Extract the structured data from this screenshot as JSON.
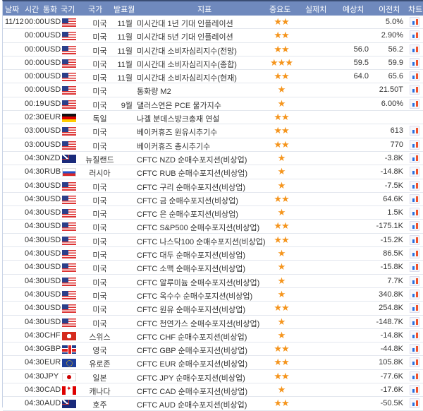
{
  "header": {
    "date": "날짜",
    "time": "시간",
    "currency": "통화",
    "flag": "국기",
    "country": "국가",
    "month": "발표월",
    "indicator": "지표",
    "importance": "중요도",
    "actual": "실제치",
    "forecast": "예상치",
    "previous": "이전치",
    "chart": "차트"
  },
  "colors": {
    "header_bg": "#6f89bd",
    "star": "#f5951d"
  },
  "rows": [
    {
      "date": "11/12",
      "time": "00:00",
      "currency": "USD",
      "flag": "us",
      "country": "미국",
      "month": "11월",
      "indicator": "미시간대 1년 기대 인플레이션",
      "stars": "★★",
      "actual": "",
      "forecast": "",
      "previous": "5.0%",
      "chart": true
    },
    {
      "date": "",
      "time": "00:00",
      "currency": "USD",
      "flag": "us",
      "country": "미국",
      "month": "11월",
      "indicator": "미시간대 5년 기대 인플레이션",
      "stars": "★★",
      "actual": "",
      "forecast": "",
      "previous": "2.90%",
      "chart": true
    },
    {
      "date": "",
      "time": "00:00",
      "currency": "USD",
      "flag": "us",
      "country": "미국",
      "month": "11월",
      "indicator": "미시간대 소비자심리지수(전망)",
      "stars": "★★",
      "actual": "",
      "forecast": "56.0",
      "previous": "56.2",
      "chart": true
    },
    {
      "date": "",
      "time": "00:00",
      "currency": "USD",
      "flag": "us",
      "country": "미국",
      "month": "11월",
      "indicator": "미시간대 소비자심리지수(종합)",
      "stars": "★★★",
      "actual": "",
      "forecast": "59.5",
      "previous": "59.9",
      "chart": true
    },
    {
      "date": "",
      "time": "00:00",
      "currency": "USD",
      "flag": "us",
      "country": "미국",
      "month": "11월",
      "indicator": "미시간대 소비자심리지수(현재)",
      "stars": "★★",
      "actual": "",
      "forecast": "64.0",
      "previous": "65.6",
      "chart": true
    },
    {
      "date": "",
      "time": "00:00",
      "currency": "USD",
      "flag": "us",
      "country": "미국",
      "month": "",
      "indicator": "통화량 M2",
      "stars": "★",
      "actual": "",
      "forecast": "",
      "previous": "21.50T",
      "chart": true
    },
    {
      "date": "",
      "time": "00:19",
      "currency": "USD",
      "flag": "us",
      "country": "미국",
      "month": "9월",
      "indicator": "댈러스연은 PCE 물가지수",
      "stars": "★",
      "actual": "",
      "forecast": "",
      "previous": "6.00%",
      "chart": true
    },
    {
      "date": "",
      "time": "02:30",
      "currency": "EUR",
      "flag": "de",
      "country": "독일",
      "month": "",
      "indicator": "나겔 분데스방크총재 연설",
      "stars": "★★",
      "actual": "",
      "forecast": "",
      "previous": "",
      "chart": false
    },
    {
      "date": "",
      "time": "03:00",
      "currency": "USD",
      "flag": "us",
      "country": "미국",
      "month": "",
      "indicator": "베이커휴즈 원유시추기수",
      "stars": "★★",
      "actual": "",
      "forecast": "",
      "previous": "613",
      "chart": true
    },
    {
      "date": "",
      "time": "03:00",
      "currency": "USD",
      "flag": "us",
      "country": "미국",
      "month": "",
      "indicator": "베이커휴즈 총시추기수",
      "stars": "★★",
      "actual": "",
      "forecast": "",
      "previous": "770",
      "chart": true
    },
    {
      "date": "",
      "time": "04:30",
      "currency": "NZD",
      "flag": "nz",
      "country": "뉴질랜드",
      "month": "",
      "indicator": "CFTC NZD 순매수포지션(비상업)",
      "stars": "★",
      "actual": "",
      "forecast": "",
      "previous": "-3.8K",
      "chart": true
    },
    {
      "date": "",
      "time": "04:30",
      "currency": "RUB",
      "flag": "ru",
      "country": "러시아",
      "month": "",
      "indicator": "CFTC RUB 순매수포지션(비상업)",
      "stars": "★",
      "actual": "",
      "forecast": "",
      "previous": "-14.8K",
      "chart": true
    },
    {
      "date": "",
      "time": "04:30",
      "currency": "USD",
      "flag": "us",
      "country": "미국",
      "month": "",
      "indicator": "CFTC 구리 순매수포지션(비상업)",
      "stars": "★",
      "actual": "",
      "forecast": "",
      "previous": "-7.5K",
      "chart": true
    },
    {
      "date": "",
      "time": "04:30",
      "currency": "USD",
      "flag": "us",
      "country": "미국",
      "month": "",
      "indicator": "CFTC 금 순매수포지션(비상업)",
      "stars": "★★",
      "actual": "",
      "forecast": "",
      "previous": "64.6K",
      "chart": true
    },
    {
      "date": "",
      "time": "04:30",
      "currency": "USD",
      "flag": "us",
      "country": "미국",
      "month": "",
      "indicator": "CFTC 은 순매수포지션(비상업)",
      "stars": "★",
      "actual": "",
      "forecast": "",
      "previous": "1.5K",
      "chart": true
    },
    {
      "date": "",
      "time": "04:30",
      "currency": "USD",
      "flag": "us",
      "country": "미국",
      "month": "",
      "indicator": "CFTC S&P500 순매수포지션(비상업)",
      "stars": "★★",
      "actual": "",
      "forecast": "",
      "previous": "-175.1K",
      "chart": true
    },
    {
      "date": "",
      "time": "04:30",
      "currency": "USD",
      "flag": "us",
      "country": "미국",
      "month": "",
      "indicator": "CFTC 나스닥100 순매수포지션(비상업)",
      "stars": "★★",
      "actual": "",
      "forecast": "",
      "previous": "-15.2K",
      "chart": true
    },
    {
      "date": "",
      "time": "04:30",
      "currency": "USD",
      "flag": "us",
      "country": "미국",
      "month": "",
      "indicator": "CFTC 대두 순매수포지션(비상업)",
      "stars": "★",
      "actual": "",
      "forecast": "",
      "previous": "86.5K",
      "chart": true
    },
    {
      "date": "",
      "time": "04:30",
      "currency": "USD",
      "flag": "us",
      "country": "미국",
      "month": "",
      "indicator": "CFTC 소맥 순매수포지션(비상업)",
      "stars": "★",
      "actual": "",
      "forecast": "",
      "previous": "-15.8K",
      "chart": true
    },
    {
      "date": "",
      "time": "04:30",
      "currency": "USD",
      "flag": "us",
      "country": "미국",
      "month": "",
      "indicator": "CFTC 알루미늄 순매수포지션(비상업)",
      "stars": "★",
      "actual": "",
      "forecast": "",
      "previous": "7.7K",
      "chart": true
    },
    {
      "date": "",
      "time": "04:30",
      "currency": "USD",
      "flag": "us",
      "country": "미국",
      "month": "",
      "indicator": "CFTC 옥수수 순매수포지션(비상업)",
      "stars": "★",
      "actual": "",
      "forecast": "",
      "previous": "340.8K",
      "chart": true
    },
    {
      "date": "",
      "time": "04:30",
      "currency": "USD",
      "flag": "us",
      "country": "미국",
      "month": "",
      "indicator": "CFTC 원유 순매수포지션(비상업)",
      "stars": "★★",
      "actual": "",
      "forecast": "",
      "previous": "254.8K",
      "chart": true
    },
    {
      "date": "",
      "time": "04:30",
      "currency": "USD",
      "flag": "us",
      "country": "미국",
      "month": "",
      "indicator": "CFTC 천연가스 순매수포지션(비상업)",
      "stars": "★",
      "actual": "",
      "forecast": "",
      "previous": "-148.7K",
      "chart": true
    },
    {
      "date": "",
      "time": "04:30",
      "currency": "CHF",
      "flag": "ch",
      "country": "스위스",
      "month": "",
      "indicator": "CFTC CHF 순매수포지션(비상업)",
      "stars": "★",
      "actual": "",
      "forecast": "",
      "previous": "-14.8K",
      "chart": true
    },
    {
      "date": "",
      "time": "04:30",
      "currency": "GBP",
      "flag": "gb",
      "country": "영국",
      "month": "",
      "indicator": "CFTC GBP 순매수포지션(비상업)",
      "stars": "★★",
      "actual": "",
      "forecast": "",
      "previous": "-44.8K",
      "chart": true
    },
    {
      "date": "",
      "time": "04:30",
      "currency": "EUR",
      "flag": "eu",
      "country": "유로존",
      "month": "",
      "indicator": "CFTC EUR 순매수포지션(비상업)",
      "stars": "★★",
      "actual": "",
      "forecast": "",
      "previous": "105.8K",
      "chart": true
    },
    {
      "date": "",
      "time": "04:30",
      "currency": "JPY",
      "flag": "jp",
      "country": "일본",
      "month": "",
      "indicator": "CFTC JPY 순매수포지션(비상업)",
      "stars": "★★",
      "actual": "",
      "forecast": "",
      "previous": "-77.6K",
      "chart": true
    },
    {
      "date": "",
      "time": "04:30",
      "currency": "CAD",
      "flag": "ca",
      "country": "캐나다",
      "month": "",
      "indicator": "CFTC CAD 순매수포지션(비상업)",
      "stars": "★",
      "actual": "",
      "forecast": "",
      "previous": "-17.6K",
      "chart": true
    },
    {
      "date": "",
      "time": "04:30",
      "currency": "AUD",
      "flag": "au",
      "country": "호주",
      "month": "",
      "indicator": "CFTC AUD 순매수포지션(비상업)",
      "stars": "★★",
      "actual": "",
      "forecast": "",
      "previous": "-50.5K",
      "chart": true
    }
  ]
}
